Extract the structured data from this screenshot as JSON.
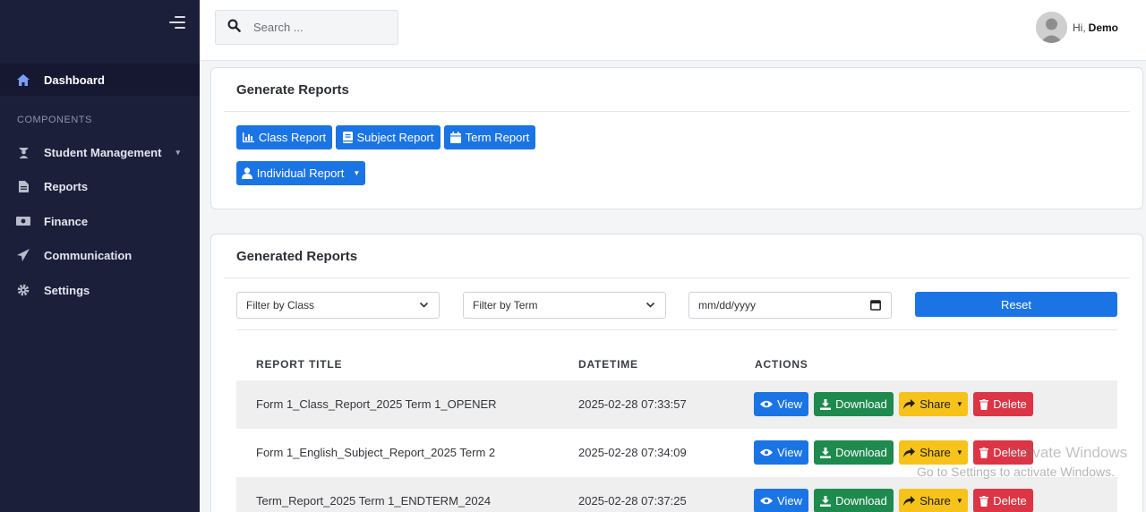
{
  "sidebar": {
    "heading": "COMPONENTS",
    "items": [
      {
        "label": "Dashboard",
        "icon": "home-icon"
      },
      {
        "label": "Student Management",
        "icon": "graduate-icon",
        "has_caret": true
      },
      {
        "label": "Reports",
        "icon": "file-icon"
      },
      {
        "label": "Finance",
        "icon": "money-icon"
      },
      {
        "label": "Communication",
        "icon": "paper-plane-icon"
      },
      {
        "label": "Settings",
        "icon": "gear-icon"
      }
    ]
  },
  "topbar": {
    "search_placeholder": "Search ...",
    "greeting": "Hi,",
    "username": "Demo"
  },
  "generate": {
    "title": "Generate Reports",
    "buttons": {
      "class_report": "Class Report",
      "subject_report": "Subject Report",
      "term_report": "Term Report",
      "individual_report": "Individual Report"
    }
  },
  "generated": {
    "title": "Generated Reports",
    "filters": {
      "class": "Filter by Class",
      "term": "Filter by Term",
      "date_placeholder": "mm/dd/yyyy",
      "reset": "Reset"
    },
    "columns": [
      "REPORT TITLE",
      "DATETIME",
      "ACTIONS"
    ],
    "actions": {
      "view": "View",
      "download": "Download",
      "share": "Share",
      "delete": "Delete"
    },
    "rows": [
      {
        "title": "Form 1_Class_Report_2025 Term 1_OPENER",
        "datetime": "2025-02-28 07:33:57"
      },
      {
        "title": "Form 1_English_Subject_Report_2025 Term 2",
        "datetime": "2025-02-28 07:34:09"
      },
      {
        "title": "Term_Report_2025 Term 1_ENDTERM_2024",
        "datetime": "2025-02-28 07:37:25"
      }
    ]
  },
  "os_watermark": {
    "line1": "Activate Windows",
    "line2": "Go to Settings to activate Windows."
  },
  "colors": {
    "sidebar_bg": "#1c1f3a",
    "primary": "#1b74e4",
    "success": "#1e8a4e",
    "warning": "#f7c21a",
    "danger": "#dc3545"
  }
}
